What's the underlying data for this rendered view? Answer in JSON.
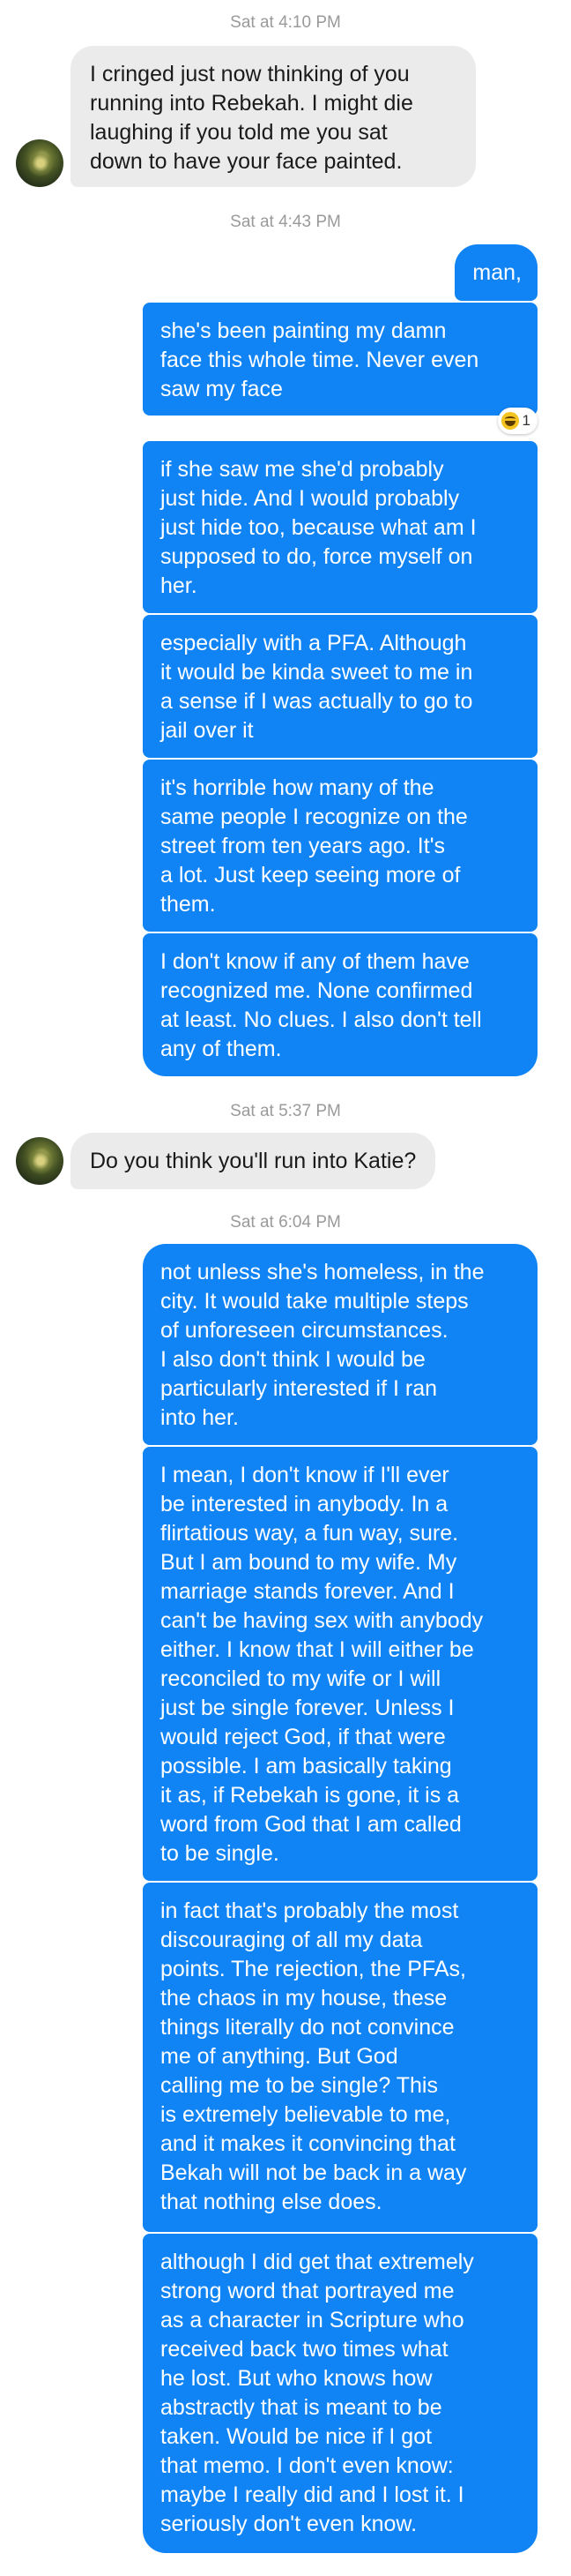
{
  "conversation": {
    "timestamps": [
      "Sat at 4:10 PM",
      "Sat at 4:43 PM",
      "Sat at 5:37 PM",
      "Sat at 6:04 PM"
    ],
    "received": [
      {
        "text": "I cringed just now thinking of you\nrunning into Rebekah. I might die\nlaughing if you told me you sat\ndown to have your face painted."
      },
      {
        "text": "Do you think you'll run into Katie?"
      }
    ],
    "sent": [
      {
        "text": "man,"
      },
      {
        "text": "she's been painting my damn\nface this whole time. Never even\nsaw my face"
      },
      {
        "text": "if she saw me she'd probably\njust hide. And I would probably\njust hide too, because what am I\nsupposed to do, force myself on\nher."
      },
      {
        "text": "especially with a PFA. Although\nit would be kinda sweet to me in\na sense if I was actually to go to\njail over it"
      },
      {
        "text": "it's horrible how many of the\nsame people I recognize on the\nstreet from ten years ago. It's\na lot. Just keep seeing more of\nthem."
      },
      {
        "text": "I don't know if any of them have\nrecognized me. None confirmed\nat least. No clues. I also don't tell\nany of them."
      },
      {
        "text": "not unless she's homeless, in the\ncity. It would take multiple steps\nof unforeseen circumstances.\nI also don't think I would be\nparticularly interested if I ran\ninto her."
      },
      {
        "text": "I mean, I don't know if I'll ever\nbe interested in anybody. In a\nflirtatious way, a fun way, sure.\nBut I am bound to my wife. My\nmarriage stands forever. And I\ncan't be having sex with anybody\neither. I know that I will either be\nreconciled to my wife or I will\njust be single forever. Unless I\nwould reject God, if that were\npossible. I am basically taking\nit as, if Rebekah is gone, it is a\nword from God that I am called\nto be single."
      },
      {
        "text": "in fact that's probably the most\ndiscouraging of all my data\npoints. The rejection, the PFAs,\nthe chaos in my house, these\nthings literally do not convince\nme of anything. But God\ncalling me to be single? This\nis extremely believable to me,\nand it makes it convincing that\nBekah will not be back in a way\nthat nothing else does."
      },
      {
        "text": "although I did get that extremely\nstrong word that portrayed me\nas a character in Scripture who\nreceived back two times what\nhe lost. But who knows how\nabstractly that is meant to be\ntaken. Would be nice if I got\nthat memo. I don't even know:\nmaybe I really did and I lost it. I\nseriously don't even know."
      }
    ],
    "reaction": {
      "icon": "laughing-emoji-icon",
      "count": "1"
    }
  },
  "colors": {
    "sent_bubble": "#1083f5",
    "received_bubble": "#ebebeb",
    "timestamp": "#9a9a9a"
  }
}
